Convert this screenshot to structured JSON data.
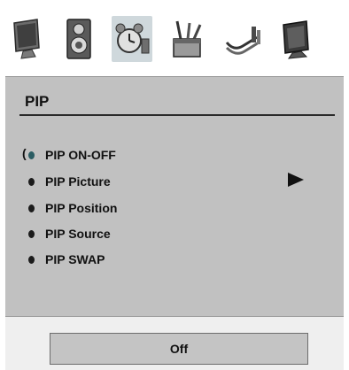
{
  "icons": [
    "monitor-icon",
    "speaker-icon",
    "alarm-clock-icon",
    "toolbox-icon",
    "cable-icon",
    "tv-icon"
  ],
  "panel": {
    "title": "PIP",
    "items": [
      {
        "label": "PIP ON-OFF",
        "selected": true
      },
      {
        "label": "PIP Picture"
      },
      {
        "label": "PIP Position"
      },
      {
        "label": "PIP Source"
      },
      {
        "label": "PIP SWAP"
      }
    ],
    "selection_marker": "("
  },
  "value_box": {
    "label": "Off"
  },
  "colors": {
    "panel": "#c1c1c1",
    "bottom_bar": "#efefef",
    "active_icon_bg": "#cfd8dc"
  }
}
